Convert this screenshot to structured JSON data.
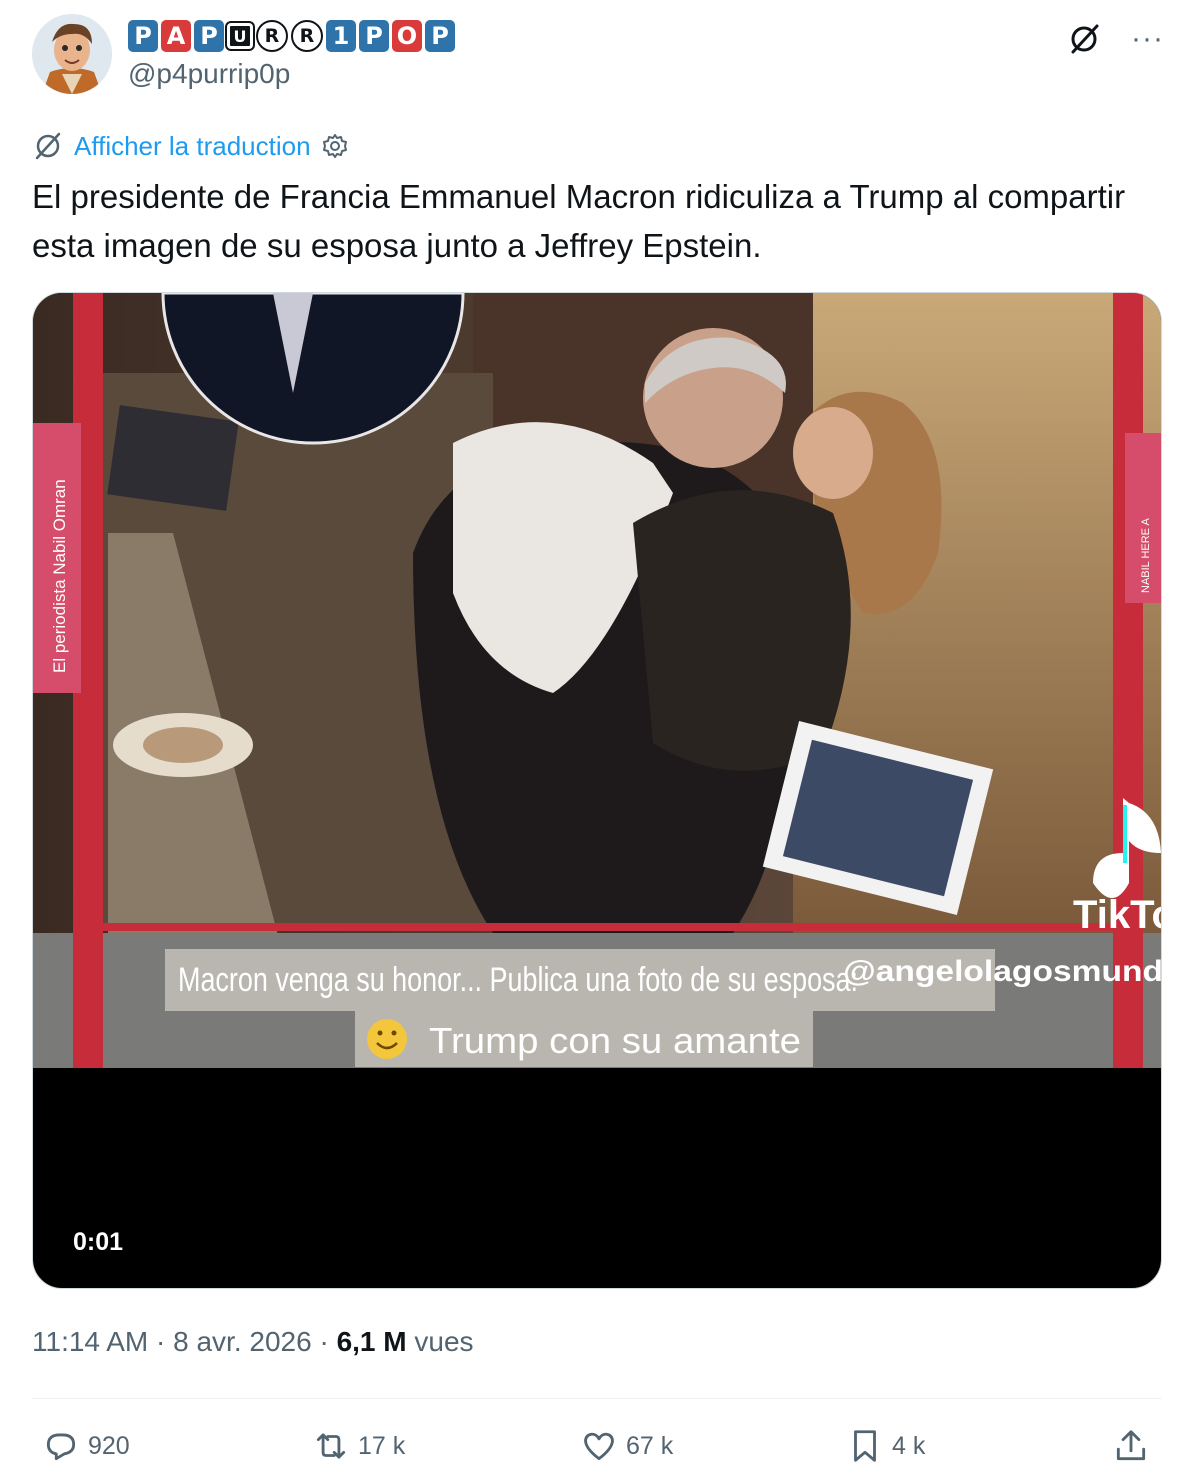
{
  "author": {
    "display_name_tiles": [
      "P",
      "A",
      "P",
      "U",
      "R",
      "R",
      "1",
      "P",
      "O",
      "P"
    ],
    "handle": "@p4purrip0p"
  },
  "translate": {
    "link_label": "Afficher la traduction"
  },
  "tweet": {
    "text": "El presidente de Francia Emmanuel Macron ridiculiza a Trump al compartir esta imagen de su esposa junto a Jeffrey Epstein."
  },
  "media": {
    "side_label_left": "El periodista Nabil Omran",
    "side_label_right": "NABIL HERE A",
    "watermark": "TikTo",
    "watermark_handle": "@angelolagosmund",
    "caption_line1": "Macron venga su honor... Publica una foto de su esposa:",
    "caption_line2": "Trump con su amante",
    "timestamp": "0:01"
  },
  "meta": {
    "time": "11:14 AM",
    "date": "8 avr. 2026",
    "views_count": "6,1 M",
    "views_label": "vues"
  },
  "actions": {
    "replies": "920",
    "reposts": "17 k",
    "likes": "67 k",
    "bookmarks": "4 k"
  }
}
